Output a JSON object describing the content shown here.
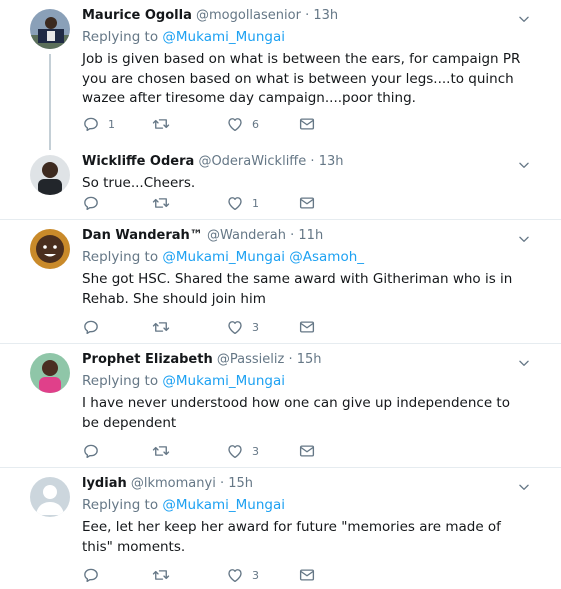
{
  "tweets": [
    {
      "name": "Maurice Ogolla",
      "handle": "@mogollasenior",
      "time": "13h",
      "replying_prefix": "Replying to",
      "mentions": "@Mukami_Mungai",
      "text": "Job is given based on what is between the ears, for campaign PR you are chosen based on what is between your legs....to quinch wazee after tiresome day campaign....poor thing.",
      "reply_count": "1",
      "retweet_count": "",
      "like_count": "6"
    },
    {
      "name": "Wickliffe Odera",
      "handle": "@OderaWickliffe",
      "time": "13h",
      "text": "So true...Cheers.",
      "reply_count": "",
      "retweet_count": "",
      "like_count": "1"
    },
    {
      "name": "Dan Wanderah™",
      "handle": "@Wanderah",
      "time": "11h",
      "replying_prefix": "Replying to",
      "mentions": "@Mukami_Mungai @Asamoh_",
      "text": "She got HSC. Shared the same award with Githeriman who is in Rehab. She should join him",
      "reply_count": "",
      "retweet_count": "",
      "like_count": "3"
    },
    {
      "name": "Prophet Elizabeth",
      "handle": "@Passieliz",
      "time": "15h",
      "replying_prefix": "Replying to",
      "mentions": "@Mukami_Mungai",
      "text": "I have never understood how one can give up independence to be dependent",
      "reply_count": "",
      "retweet_count": "",
      "like_count": "3"
    },
    {
      "name": "lydiah",
      "handle": "@lkmomanyi",
      "time": "15h",
      "replying_prefix": "Replying to",
      "mentions": "@Mukami_Mungai",
      "text": "Eee, let her keep her award for future \"memories are made of this\" moments.",
      "reply_count": "",
      "retweet_count": "",
      "like_count": "3"
    }
  ],
  "separator": "·",
  "icons": {
    "reply": "reply-icon",
    "retweet": "retweet-icon",
    "like": "heart-icon",
    "dm": "envelope-icon",
    "menu": "chevron-down-icon"
  },
  "colors": {
    "link": "#1da1f2",
    "secondary_text": "#657786",
    "primary_text": "#14171a",
    "divider": "#e6ecf0",
    "thread_line": "#c4cfd6"
  }
}
